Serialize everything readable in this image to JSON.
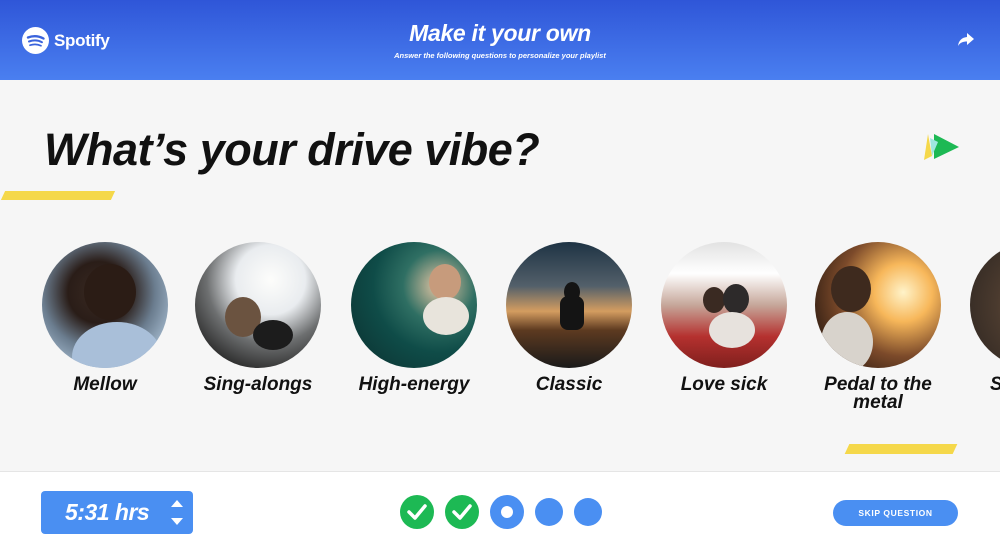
{
  "header": {
    "logo_text": "Spotify",
    "title": "Make it your own",
    "subtitle": "Answer the following questions to personalize your playlist",
    "share_icon": "share-arrow-icon"
  },
  "main": {
    "question": "What’s your drive vibe?",
    "vibes": [
      {
        "label": "Mellow",
        "image": "smiling man in car"
      },
      {
        "label": "Sing-alongs",
        "image": "woman driving convertible"
      },
      {
        "label": "High-energy",
        "image": "man in green convertible"
      },
      {
        "label": "Classic",
        "image": "person on car at sunset"
      },
      {
        "label": "Love sick",
        "image": "couple in red convertible"
      },
      {
        "label": "Pedal to the metal",
        "image": "man driving at sunset"
      },
      {
        "label": "S",
        "image": "partial"
      }
    ]
  },
  "footer": {
    "duration": "5:31 hrs",
    "progress": {
      "total": 5,
      "completed": 2,
      "current": 3
    },
    "skip_label": "SKIP QUESTION"
  },
  "colors": {
    "header_gradient_top": "#2f56d8",
    "header_gradient_bottom": "#4a7ff0",
    "accent_blue": "#4a8ff2",
    "check_green": "#1db954",
    "stripe_yellow": "#f5d84a"
  }
}
